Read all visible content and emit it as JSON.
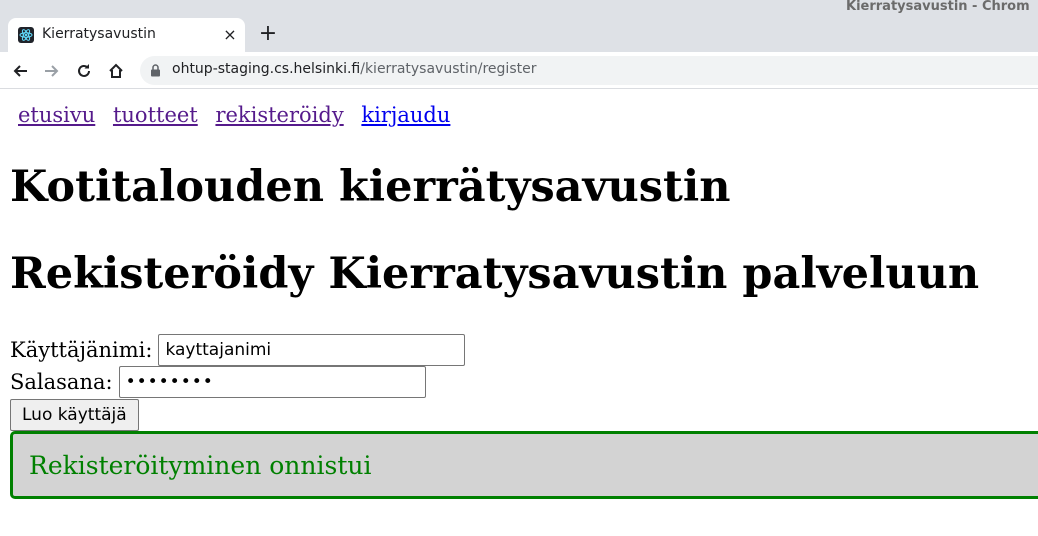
{
  "window": {
    "title": "Kierratysavustin - Chrom"
  },
  "tab": {
    "title": "Kierratysavustin",
    "close_glyph": "×",
    "new_tab_glyph": "+"
  },
  "omnibox": {
    "host": "ohtup-staging.cs.helsinki.fi",
    "path": "/kierratysavustin/register"
  },
  "nav": {
    "items": [
      {
        "label": "etusivu",
        "state": "visited"
      },
      {
        "label": "tuotteet",
        "state": "visited"
      },
      {
        "label": "rekisteröidy",
        "state": "visited"
      },
      {
        "label": "kirjaudu",
        "state": "link"
      }
    ]
  },
  "page": {
    "title": "Kotitalouden kierrätysavustin",
    "heading": "Rekisteröidy Kierratysavustin palveluun"
  },
  "form": {
    "username_label": "Käyttäjänimi:",
    "username_value": "kayttajanimi",
    "password_label": "Salasana:",
    "password_value": "••••••••",
    "submit_label": "Luo käyttäjä"
  },
  "notification": {
    "message": "Rekisteröityminen onnistui",
    "color": "#008000"
  },
  "icons": {
    "favicon": "react-logo-icon",
    "back": "arrow-left-icon",
    "forward": "arrow-right-icon",
    "reload": "reload-icon",
    "home": "home-icon",
    "lock": "lock-icon"
  }
}
